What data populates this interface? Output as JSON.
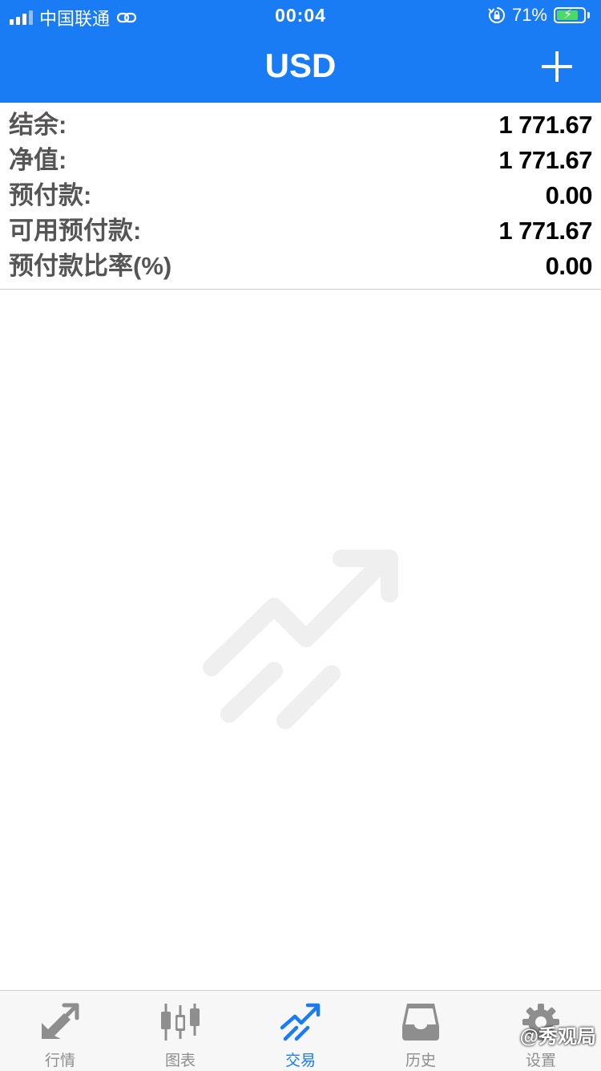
{
  "status_bar": {
    "carrier": "中国联通",
    "time": "00:04",
    "battery_percent": "71%",
    "battery_level": 0.71
  },
  "nav": {
    "title": "USD",
    "add_icon": "plus-icon"
  },
  "summary": {
    "rows": [
      {
        "label": "结余:",
        "value": "1 771.67"
      },
      {
        "label": "净值:",
        "value": "1 771.67"
      },
      {
        "label": "预付款:",
        "value": "0.00"
      },
      {
        "label": "可用预付款:",
        "value": "1 771.67"
      },
      {
        "label": "预付款比率(%)",
        "value": "0.00"
      }
    ]
  },
  "empty_state": {
    "icon": "trade-arrow-placeholder-icon"
  },
  "tabbar": {
    "tabs": [
      {
        "label": "行情",
        "icon": "quotes-arrows-icon",
        "active": false
      },
      {
        "label": "图表",
        "icon": "candlestick-icon",
        "active": false
      },
      {
        "label": "交易",
        "icon": "trade-trend-icon",
        "active": true
      },
      {
        "label": "历史",
        "icon": "inbox-tray-icon",
        "active": false
      },
      {
        "label": "设置",
        "icon": "gear-icon",
        "active": false
      }
    ]
  },
  "watermark": "@秀观局",
  "colors": {
    "accent": "#1a7cf5",
    "tab_inactive": "#8e8e8e",
    "placeholder": "#efefef"
  }
}
